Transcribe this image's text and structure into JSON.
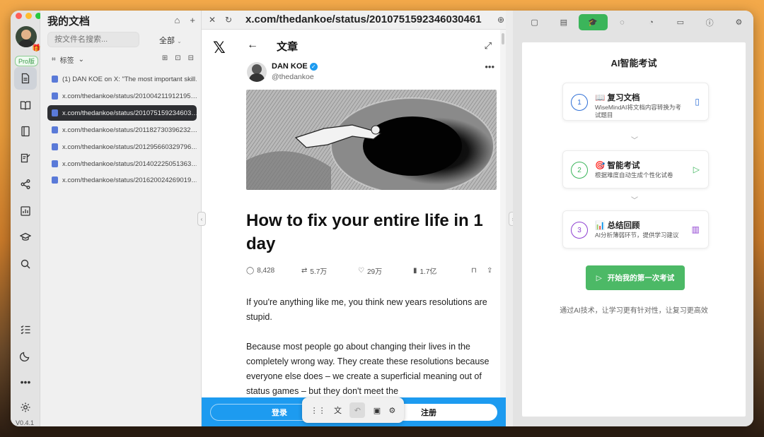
{
  "app": {
    "version": "V0.4.1",
    "pro_badge": "Pro版"
  },
  "files": {
    "title": "我的文档",
    "search_placeholder": "按文件名搜索...",
    "filter": "全部",
    "tag_label": "标签",
    "items": [
      "(1) DAN KOE on X: \"The most important skill…",
      "x.com/thedankoe/status/201004211912195…",
      "x.com/thedankoe/status/201075159234603…",
      "x.com/thedankoe/status/201182730396232…",
      "x.com/thedankoe/status/201295660329796…",
      "x.com/thedankoe/status/201402225051363…",
      "x.com/thedankoe/status/201620024269019…"
    ]
  },
  "browser": {
    "url": "x.com/thedankoe/status/2010751592346030461",
    "header": "文章",
    "author_name": "DAN KOE",
    "author_handle": "@thedankoe",
    "article_title": "How to fix your entire life in 1 day",
    "stats": {
      "replies": "8,428",
      "reposts": "5.7万",
      "likes": "29万",
      "views": "1.7亿"
    },
    "body": [
      "If you're anything like me, you think new years resolutions are stupid.",
      "Because most people go about changing their lives in the completely wrong way. They create these resolutions because everyone else does – we create a superficial meaning out of status games – but they don't meet the"
    ],
    "login_label": "登录",
    "signup_label": "注册"
  },
  "ai": {
    "title": "AI智能考试",
    "steps": [
      {
        "num": "1",
        "name": "📖 复习文档",
        "desc": "WiseMindAI将文档内容转换为考试题目",
        "color": "#2f6fd6"
      },
      {
        "num": "2",
        "name": "🎯 智能考试",
        "desc": "根据难度自动生成个性化试卷",
        "color": "#3bb55a"
      },
      {
        "num": "3",
        "name": "📊 总结回顾",
        "desc": "AI分析薄弱环节，提供学习建议",
        "color": "#8e3fd1"
      }
    ],
    "start_label": "开始我的第一次考试",
    "footer": "通过AI技术，让学习更有针对性，让复习更高效",
    "accent": "#4cb966"
  }
}
